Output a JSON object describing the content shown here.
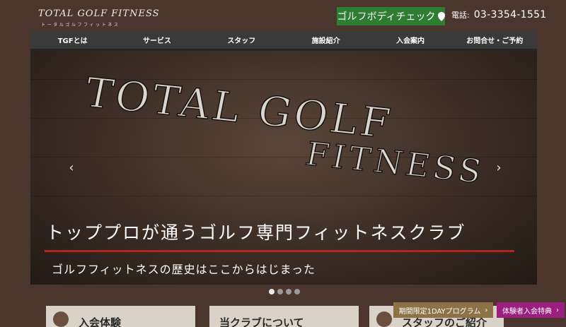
{
  "header": {
    "logo_main": "TOTAL GOLF FITNESS",
    "logo_sub": "トータルゴルフフィットネス",
    "check_button": "ゴルフボディチェック",
    "phone_label": "電話:",
    "phone_number": "03-3354-1551"
  },
  "nav": {
    "items": [
      {
        "label": "TGFとは"
      },
      {
        "label": "サービス"
      },
      {
        "label": "スタッフ"
      },
      {
        "label": "施設紹介"
      },
      {
        "label": "入会案内"
      },
      {
        "label": "お問合せ・ご予約"
      }
    ]
  },
  "hero": {
    "sign_line1": "TOTAL GOLF",
    "sign_line2": "FITNESS",
    "title": "トッププロが通うゴルフ専門フィットネスクラブ",
    "subtitle": "ゴルフフィットネスの歴史はここからはじまった",
    "prev_arrow": "‹",
    "next_arrow": "›",
    "slide_count": 4,
    "active_slide": 1
  },
  "cards": [
    {
      "text": "入会体験"
    },
    {
      "text": "当クラブについて"
    },
    {
      "text": "スタッフのご紹介"
    }
  ],
  "promos": {
    "oneday": "期間限定1DAYプログラム",
    "trial": "体験者入会特典",
    "chevron": "›"
  },
  "colors": {
    "background": "#4a362c",
    "check_button": "#2e7d32",
    "accent_red": "#b3261e",
    "promo_gold": "#8c7245",
    "promo_magenta": "#9b1f7e"
  }
}
